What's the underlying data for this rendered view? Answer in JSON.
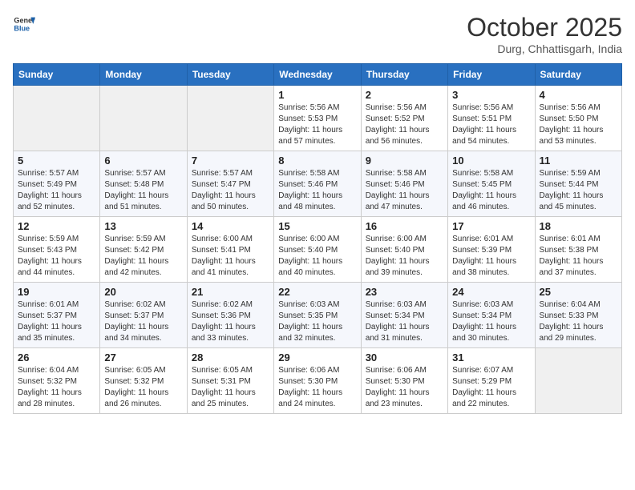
{
  "header": {
    "logo_line1": "General",
    "logo_line2": "Blue",
    "month": "October 2025",
    "location": "Durg, Chhattisgarh, India"
  },
  "weekdays": [
    "Sunday",
    "Monday",
    "Tuesday",
    "Wednesday",
    "Thursday",
    "Friday",
    "Saturday"
  ],
  "weeks": [
    [
      {
        "day": "",
        "info": ""
      },
      {
        "day": "",
        "info": ""
      },
      {
        "day": "",
        "info": ""
      },
      {
        "day": "1",
        "info": "Sunrise: 5:56 AM\nSunset: 5:53 PM\nDaylight: 11 hours\nand 57 minutes."
      },
      {
        "day": "2",
        "info": "Sunrise: 5:56 AM\nSunset: 5:52 PM\nDaylight: 11 hours\nand 56 minutes."
      },
      {
        "day": "3",
        "info": "Sunrise: 5:56 AM\nSunset: 5:51 PM\nDaylight: 11 hours\nand 54 minutes."
      },
      {
        "day": "4",
        "info": "Sunrise: 5:56 AM\nSunset: 5:50 PM\nDaylight: 11 hours\nand 53 minutes."
      }
    ],
    [
      {
        "day": "5",
        "info": "Sunrise: 5:57 AM\nSunset: 5:49 PM\nDaylight: 11 hours\nand 52 minutes."
      },
      {
        "day": "6",
        "info": "Sunrise: 5:57 AM\nSunset: 5:48 PM\nDaylight: 11 hours\nand 51 minutes."
      },
      {
        "day": "7",
        "info": "Sunrise: 5:57 AM\nSunset: 5:47 PM\nDaylight: 11 hours\nand 50 minutes."
      },
      {
        "day": "8",
        "info": "Sunrise: 5:58 AM\nSunset: 5:46 PM\nDaylight: 11 hours\nand 48 minutes."
      },
      {
        "day": "9",
        "info": "Sunrise: 5:58 AM\nSunset: 5:46 PM\nDaylight: 11 hours\nand 47 minutes."
      },
      {
        "day": "10",
        "info": "Sunrise: 5:58 AM\nSunset: 5:45 PM\nDaylight: 11 hours\nand 46 minutes."
      },
      {
        "day": "11",
        "info": "Sunrise: 5:59 AM\nSunset: 5:44 PM\nDaylight: 11 hours\nand 45 minutes."
      }
    ],
    [
      {
        "day": "12",
        "info": "Sunrise: 5:59 AM\nSunset: 5:43 PM\nDaylight: 11 hours\nand 44 minutes."
      },
      {
        "day": "13",
        "info": "Sunrise: 5:59 AM\nSunset: 5:42 PM\nDaylight: 11 hours\nand 42 minutes."
      },
      {
        "day": "14",
        "info": "Sunrise: 6:00 AM\nSunset: 5:41 PM\nDaylight: 11 hours\nand 41 minutes."
      },
      {
        "day": "15",
        "info": "Sunrise: 6:00 AM\nSunset: 5:40 PM\nDaylight: 11 hours\nand 40 minutes."
      },
      {
        "day": "16",
        "info": "Sunrise: 6:00 AM\nSunset: 5:40 PM\nDaylight: 11 hours\nand 39 minutes."
      },
      {
        "day": "17",
        "info": "Sunrise: 6:01 AM\nSunset: 5:39 PM\nDaylight: 11 hours\nand 38 minutes."
      },
      {
        "day": "18",
        "info": "Sunrise: 6:01 AM\nSunset: 5:38 PM\nDaylight: 11 hours\nand 37 minutes."
      }
    ],
    [
      {
        "day": "19",
        "info": "Sunrise: 6:01 AM\nSunset: 5:37 PM\nDaylight: 11 hours\nand 35 minutes."
      },
      {
        "day": "20",
        "info": "Sunrise: 6:02 AM\nSunset: 5:37 PM\nDaylight: 11 hours\nand 34 minutes."
      },
      {
        "day": "21",
        "info": "Sunrise: 6:02 AM\nSunset: 5:36 PM\nDaylight: 11 hours\nand 33 minutes."
      },
      {
        "day": "22",
        "info": "Sunrise: 6:03 AM\nSunset: 5:35 PM\nDaylight: 11 hours\nand 32 minutes."
      },
      {
        "day": "23",
        "info": "Sunrise: 6:03 AM\nSunset: 5:34 PM\nDaylight: 11 hours\nand 31 minutes."
      },
      {
        "day": "24",
        "info": "Sunrise: 6:03 AM\nSunset: 5:34 PM\nDaylight: 11 hours\nand 30 minutes."
      },
      {
        "day": "25",
        "info": "Sunrise: 6:04 AM\nSunset: 5:33 PM\nDaylight: 11 hours\nand 29 minutes."
      }
    ],
    [
      {
        "day": "26",
        "info": "Sunrise: 6:04 AM\nSunset: 5:32 PM\nDaylight: 11 hours\nand 28 minutes."
      },
      {
        "day": "27",
        "info": "Sunrise: 6:05 AM\nSunset: 5:32 PM\nDaylight: 11 hours\nand 26 minutes."
      },
      {
        "day": "28",
        "info": "Sunrise: 6:05 AM\nSunset: 5:31 PM\nDaylight: 11 hours\nand 25 minutes."
      },
      {
        "day": "29",
        "info": "Sunrise: 6:06 AM\nSunset: 5:30 PM\nDaylight: 11 hours\nand 24 minutes."
      },
      {
        "day": "30",
        "info": "Sunrise: 6:06 AM\nSunset: 5:30 PM\nDaylight: 11 hours\nand 23 minutes."
      },
      {
        "day": "31",
        "info": "Sunrise: 6:07 AM\nSunset: 5:29 PM\nDaylight: 11 hours\nand 22 minutes."
      },
      {
        "day": "",
        "info": ""
      }
    ]
  ]
}
